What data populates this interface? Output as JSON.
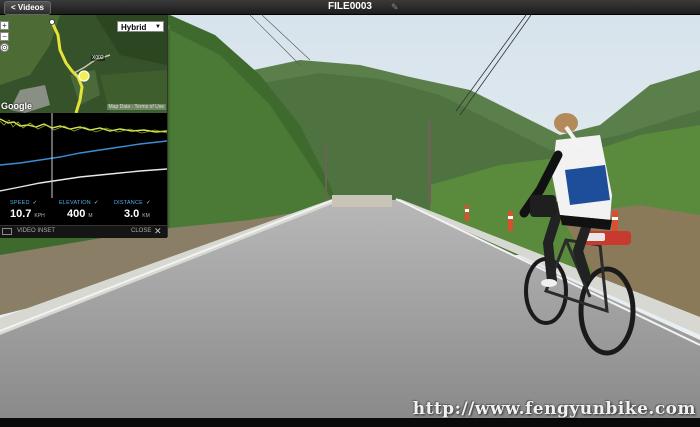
{
  "toolbar": {
    "back_label": "< Videos",
    "file_title": "FILE0003",
    "edit_icon": "pencil-icon"
  },
  "map": {
    "type_selected": "Hybrid",
    "zoom_in": "+",
    "zoom_out": "−",
    "logo": "Google",
    "attribution": "Map Data · Terms of Use",
    "road_label": "X002"
  },
  "stats": {
    "speed": {
      "label": "SPEED",
      "value": "10.7",
      "unit": "KPH"
    },
    "elevation": {
      "label": "ELEVATION",
      "value": "400",
      "unit": "M"
    },
    "distance": {
      "label": "DISTANCE",
      "value": "3.0",
      "unit": "KM"
    }
  },
  "inset_footer": {
    "video_inset_label": "VIDEO INSET",
    "close_label": "CLOSE"
  },
  "watermark": "http://www.fengyunbike.com",
  "colors": {
    "speed_line": "#d4e84a",
    "elevation_line": "#3a8ed6",
    "distance_line": "#e8e8e8",
    "label_blue": "#4fb0e8"
  }
}
